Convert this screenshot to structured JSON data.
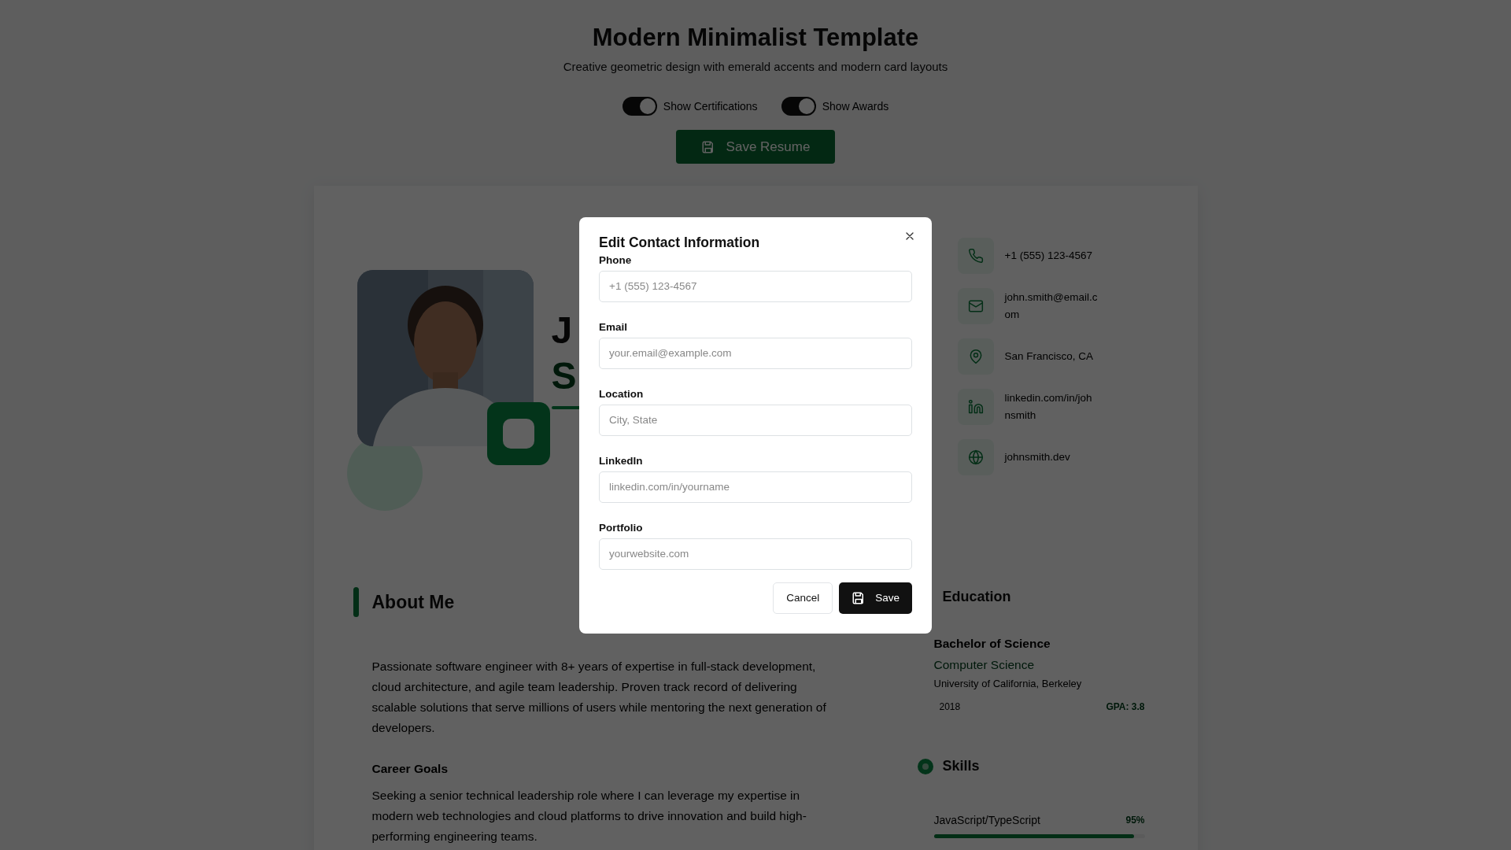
{
  "header": {
    "title": "Modern Minimalist Template",
    "subtitle": "Creative geometric design with emerald accents and modern card layouts"
  },
  "toggles": [
    {
      "label": "Show Certifications",
      "on": true
    },
    {
      "label": "Show Awards",
      "on": true
    }
  ],
  "save_button": "Save Resume",
  "profile": {
    "name": "J",
    "title": "S"
  },
  "contacts": [
    {
      "kind": "phone",
      "text": "+1 (555) 123-4567"
    },
    {
      "kind": "email",
      "text": "john.smith@email.com"
    },
    {
      "kind": "location",
      "text": "San Francisco, CA"
    },
    {
      "kind": "linkedin",
      "text": "linkedin.com/in/johnsmith"
    },
    {
      "kind": "web",
      "text": "johnsmith.dev"
    }
  ],
  "about": {
    "title": "About Me",
    "text": "Passionate software engineer with 8+ years of expertise in full-stack development, cloud architecture, and agile team leadership. Proven track record of delivering scalable solutions that serve millions of users while mentoring the next generation of developers.",
    "goals_title": "Career Goals",
    "goals_text": "Seeking a senior technical leadership role where I can leverage my expertise in modern web technologies and cloud platforms to drive innovation and build high-performing engineering teams."
  },
  "education": {
    "title": "Education",
    "degree": "Bachelor of Science",
    "field": "Computer Science",
    "school": "University of California, Berkeley",
    "year": "2018",
    "gpa": "GPA: 3.8"
  },
  "skills": {
    "title": "Skills",
    "items": [
      {
        "name": "JavaScript/TypeScript",
        "reading": "95%",
        "level": 0.95
      }
    ]
  },
  "modal": {
    "title": "Edit Contact Information",
    "fields": [
      {
        "label": "Phone",
        "placeholder": "+1 (555) 123-4567"
      },
      {
        "label": "Email",
        "placeholder": "your.email@example.com"
      },
      {
        "label": "Location",
        "placeholder": "City, State"
      },
      {
        "label": "LinkedIn",
        "placeholder": "linkedin.com/in/yourname"
      },
      {
        "label": "Portfolio",
        "placeholder": "yourwebsite.com"
      }
    ],
    "cancel": "Cancel",
    "save": "Save"
  }
}
